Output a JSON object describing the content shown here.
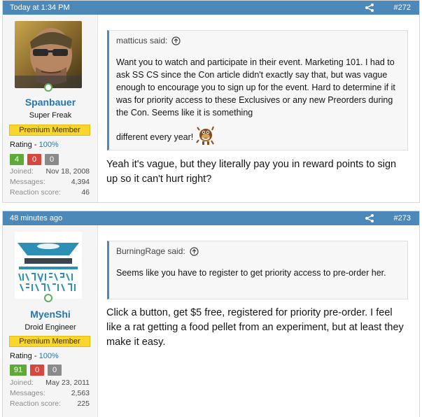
{
  "posts": [
    {
      "timestamp": "Today at 1:34 PM",
      "post_number": "#272",
      "user": {
        "name": "Spanbauer",
        "title": "Super Freak",
        "banner": "Premium Member",
        "rating_label": "Rating - ",
        "rating_pct": "100%",
        "positive": "4",
        "negative": "0",
        "neutral": "0",
        "stats": [
          {
            "label": "Joined:",
            "value": "Nov 18, 2008"
          },
          {
            "label": "Messages:",
            "value": "4,394"
          },
          {
            "label": "Reaction score:",
            "value": "46"
          }
        ]
      },
      "quote": {
        "author": "matticus said:",
        "text_main": "Want you to watch and participate in their event. Marketing 101. I had to ask SS CS since the Con article didn't exactly say that, but was vague enough to encourage you to sign up for the event. Hard to determine if it was for priority access to these Exclusives or any new Preorders during the Con. Seems like it is something",
        "text_tail": "different every year!"
      },
      "message": "Yeah it's vague, but they literally pay you in reward points to sign up so it can't hurt right?"
    },
    {
      "timestamp": "48 minutes ago",
      "post_number": "#273",
      "user": {
        "name": "MyenShi",
        "title": "Droid Engineer",
        "banner": "Premium Member",
        "rating_label": "Rating - ",
        "rating_pct": "100%",
        "positive": "91",
        "negative": "0",
        "neutral": "0",
        "stats": [
          {
            "label": "Joined:",
            "value": "May 23, 2011"
          },
          {
            "label": "Messages:",
            "value": "2,563"
          },
          {
            "label": "Reaction score:",
            "value": "225"
          }
        ]
      },
      "quote": {
        "author": "BurningRage said:",
        "text_main": "Seems like you have to register to get priority access to pre-order her."
      },
      "message": "Click a button, get $5 free, registered for priority pre-order. I feel like a rat getting a food pellet from an experiment, but at least they make it easy."
    }
  ],
  "colors": {
    "header": "#4c88b8",
    "username": "#2577b1",
    "banner": "#f8d62b",
    "positive": "#5fa939",
    "negative": "#d6473d",
    "neutral": "#8a8a8a"
  }
}
